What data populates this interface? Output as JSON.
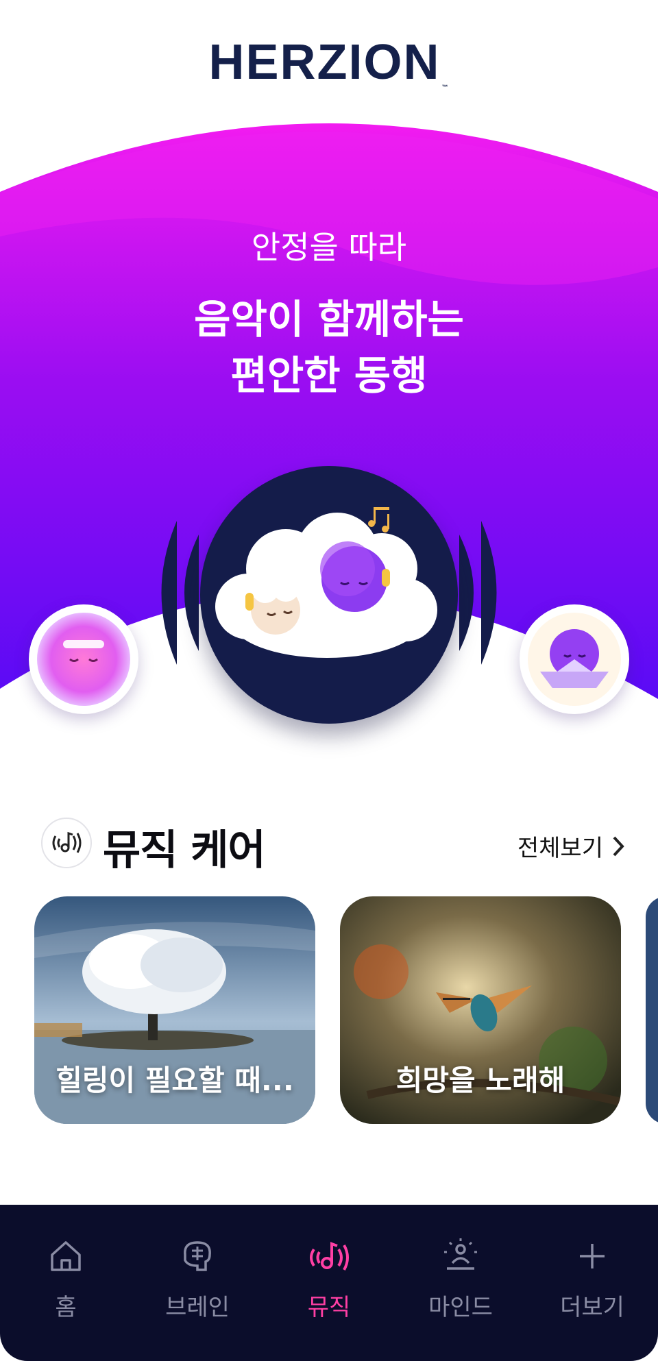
{
  "header": {
    "logo": "HERZION",
    "logo_tm": "™"
  },
  "hero": {
    "subtitle": "안정을 따라",
    "title_line1": "음악이 함께하는",
    "title_line2": "편안한 동행",
    "colors": {
      "top": "#f21bf0",
      "mid": "#9a0df2",
      "bottom": "#5a0bf5",
      "disc": "#141c4a"
    }
  },
  "music_care": {
    "title": "뮤직 케어",
    "see_all": "전체보기",
    "icon": "music-note-waves-icon",
    "cards": [
      {
        "label": "힐링이 필요할 때..."
      },
      {
        "label": "희망을 노래해"
      }
    ]
  },
  "nav": {
    "items": [
      {
        "label": "홈",
        "icon": "home-icon"
      },
      {
        "label": "브레인",
        "icon": "brain-icon"
      },
      {
        "label": "뮤직",
        "icon": "music-icon",
        "active": true
      },
      {
        "label": "마인드",
        "icon": "meditation-icon"
      },
      {
        "label": "더보기",
        "icon": "plus-icon"
      }
    ],
    "active_color": "#ff3fa4",
    "inactive_color": "#8a8ca4",
    "background": "#0b0d2b"
  }
}
